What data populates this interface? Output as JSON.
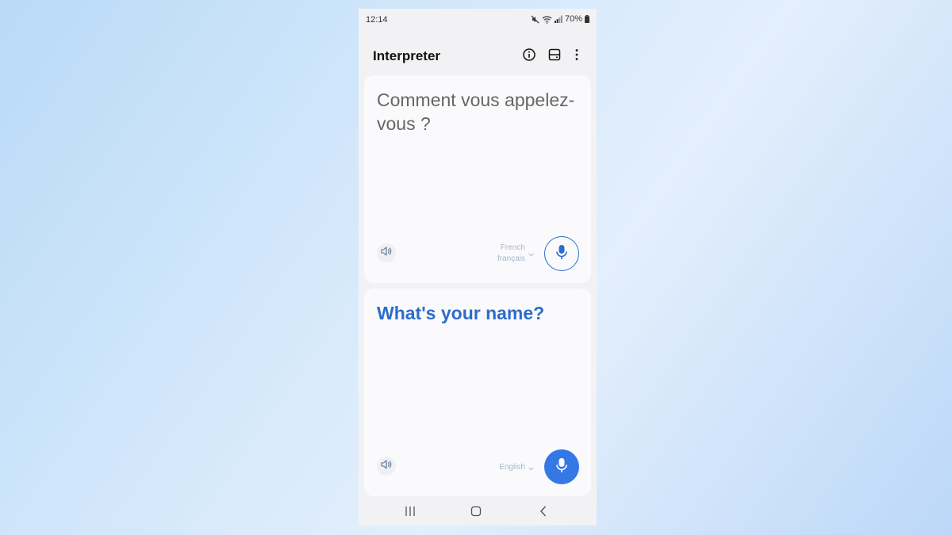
{
  "status_bar": {
    "time": "12:14",
    "battery": "70%",
    "icons": [
      "mute-icon",
      "wifi-icon",
      "signal-icon",
      "battery-icon"
    ]
  },
  "app_bar": {
    "title": "Interpreter",
    "actions": [
      "info-icon",
      "split-view-icon",
      "more-options-icon"
    ]
  },
  "source_panel": {
    "text": "Comment vous appelez-vous ?",
    "language_name": "French",
    "language_native": "français",
    "icons": [
      "speaker-icon",
      "chevron-down-icon",
      "microphone-icon"
    ]
  },
  "target_panel": {
    "text": "What's your name?",
    "language_name": "English",
    "icons": [
      "speaker-icon",
      "chevron-down-icon",
      "microphone-icon"
    ]
  },
  "nav_bar": {
    "buttons": [
      "recent-apps-icon",
      "home-icon",
      "back-icon"
    ]
  },
  "colors": {
    "accent": "#3478e6",
    "target_text": "#2d6ccd",
    "language_label": "#a9b7cc",
    "card_background": "#fafafc",
    "app_background": "#f2f2f4"
  }
}
